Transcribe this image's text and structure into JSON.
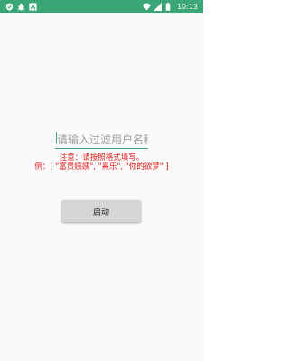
{
  "status_bar": {
    "time": "10:13",
    "left_icons": [
      "shield-check-icon",
      "bug-icon",
      "font-a-icon"
    ],
    "right_icons": [
      "wifi-icon",
      "signal-icon",
      "battery-icon"
    ],
    "background_color": "#3aa676"
  },
  "main": {
    "filter_input": {
      "value": "",
      "placeholder": "请输入过滤用户名称"
    },
    "note_line1": "注意：请按照格式填写。",
    "note_line2": "例：[ \"富贵姨姨\", \"熹乐\", \"你的欲梦\" ]",
    "note_color": "#e02020",
    "start_button_label": "启动"
  },
  "accent_color": "#3aa676"
}
